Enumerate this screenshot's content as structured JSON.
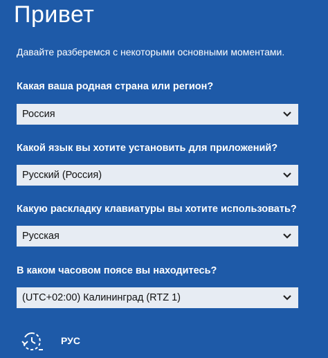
{
  "header": {
    "title": "Привет",
    "subtitle": "Давайте разберемся с некоторыми основными моментами."
  },
  "form": {
    "country_question": "Какая ваша родная страна или регион?",
    "country_value": "Россия",
    "app_language_question": "Какой язык вы хотите установить для приложений?",
    "app_language_value": "Русский (Россия)",
    "keyboard_question": "Какую раскладку клавиатуры вы хотите использовать?",
    "keyboard_value": "Русская",
    "timezone_question": "В каком часовом поясе вы находитесь?",
    "timezone_value": "(UTC+02:00) Калининград (RTZ 1)"
  },
  "bottom_bar": {
    "ease_of_access_icon": "ease-of-access-icon",
    "language_indicator": "РУС"
  },
  "colors": {
    "background": "#1e5aa8",
    "select_background": "#e7ecf3",
    "text": "#ffffff"
  }
}
